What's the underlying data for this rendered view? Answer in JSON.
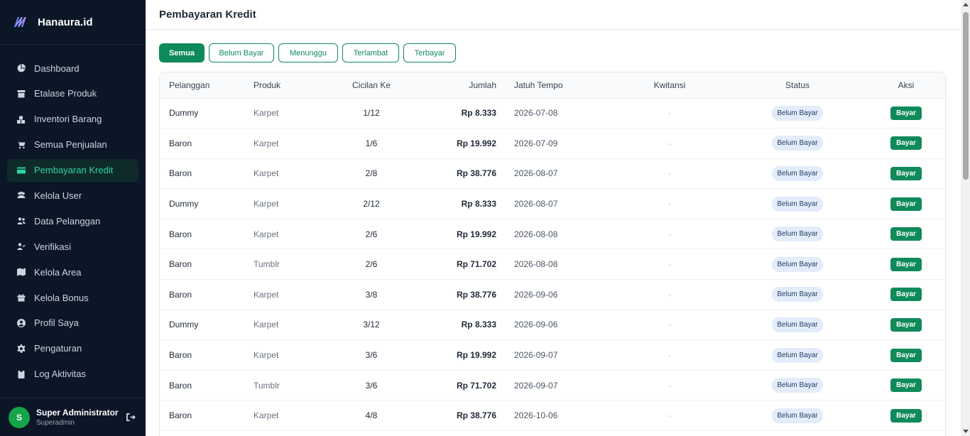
{
  "brand": {
    "name": "Hanaura.id"
  },
  "sidebar": {
    "items": [
      {
        "label": "Dashboard",
        "icon": "pie-chart-icon"
      },
      {
        "label": "Etalase Produk",
        "icon": "box-icon"
      },
      {
        "label": "Inventori Barang",
        "icon": "warehouse-icon"
      },
      {
        "label": "Semua Penjualan",
        "icon": "cart-icon"
      },
      {
        "label": "Pembayaran Kredit",
        "icon": "credit-card-icon",
        "active": true
      },
      {
        "label": "Kelola User",
        "icon": "users-icon"
      },
      {
        "label": "Data Pelanggan",
        "icon": "customers-icon"
      },
      {
        "label": "Verifikasi",
        "icon": "user-check-icon"
      },
      {
        "label": "Kelola Area",
        "icon": "map-icon"
      },
      {
        "label": "Kelola Bonus",
        "icon": "gift-icon"
      },
      {
        "label": "Profil Saya",
        "icon": "user-circle-icon"
      },
      {
        "label": "Pengaturan",
        "icon": "gear-icon"
      },
      {
        "label": "Log Aktivitas",
        "icon": "clipboard-icon"
      }
    ]
  },
  "user": {
    "initial": "S",
    "name": "Super Administrator",
    "role": "Superadmin"
  },
  "header": {
    "title": "Pembayaran Kredit"
  },
  "filters": [
    {
      "label": "Semua",
      "active": true
    },
    {
      "label": "Belum Bayar"
    },
    {
      "label": "Menunggu"
    },
    {
      "label": "Terlambat"
    },
    {
      "label": "Terbayar"
    }
  ],
  "table": {
    "columns": [
      "Pelanggan",
      "Produk",
      "Cicilan Ke",
      "Jumlah",
      "Jatuh Tempo",
      "Kwitansi",
      "Status",
      "Aksi"
    ],
    "rows": [
      {
        "pelanggan": "Dummy",
        "produk": "Karpet",
        "cicilan": "1/12",
        "jumlah": "Rp 8.333",
        "jatuh_tempo": "2026-07-08",
        "kwitansi": "-",
        "status": "Belum Bayar",
        "aksi": "Bayar"
      },
      {
        "pelanggan": "Baron",
        "produk": "Karpet",
        "cicilan": "1/6",
        "jumlah": "Rp 19.992",
        "jatuh_tempo": "2026-07-09",
        "kwitansi": "-",
        "status": "Belum Bayar",
        "aksi": "Bayar"
      },
      {
        "pelanggan": "Baron",
        "produk": "Karpet",
        "cicilan": "2/8",
        "jumlah": "Rp 38.776",
        "jatuh_tempo": "2026-08-07",
        "kwitansi": "-",
        "status": "Belum Bayar",
        "aksi": "Bayar"
      },
      {
        "pelanggan": "Dummy",
        "produk": "Karpet",
        "cicilan": "2/12",
        "jumlah": "Rp 8.333",
        "jatuh_tempo": "2026-08-07",
        "kwitansi": "-",
        "status": "Belum Bayar",
        "aksi": "Bayar"
      },
      {
        "pelanggan": "Baron",
        "produk": "Karpet",
        "cicilan": "2/6",
        "jumlah": "Rp 19.992",
        "jatuh_tempo": "2026-08-08",
        "kwitansi": "-",
        "status": "Belum Bayar",
        "aksi": "Bayar"
      },
      {
        "pelanggan": "Baron",
        "produk": "Tumblr",
        "cicilan": "2/6",
        "jumlah": "Rp 71.702",
        "jatuh_tempo": "2026-08-08",
        "kwitansi": "-",
        "status": "Belum Bayar",
        "aksi": "Bayar"
      },
      {
        "pelanggan": "Baron",
        "produk": "Karpet",
        "cicilan": "3/8",
        "jumlah": "Rp 38.776",
        "jatuh_tempo": "2026-09-06",
        "kwitansi": "-",
        "status": "Belum Bayar",
        "aksi": "Bayar"
      },
      {
        "pelanggan": "Dummy",
        "produk": "Karpet",
        "cicilan": "3/12",
        "jumlah": "Rp 8.333",
        "jatuh_tempo": "2026-09-06",
        "kwitansi": "-",
        "status": "Belum Bayar",
        "aksi": "Bayar"
      },
      {
        "pelanggan": "Baron",
        "produk": "Karpet",
        "cicilan": "3/6",
        "jumlah": "Rp 19.992",
        "jatuh_tempo": "2026-09-07",
        "kwitansi": "-",
        "status": "Belum Bayar",
        "aksi": "Bayar"
      },
      {
        "pelanggan": "Baron",
        "produk": "Tumblr",
        "cicilan": "3/6",
        "jumlah": "Rp 71.702",
        "jatuh_tempo": "2026-09-07",
        "kwitansi": "-",
        "status": "Belum Bayar",
        "aksi": "Bayar"
      },
      {
        "pelanggan": "Baron",
        "produk": "Karpet",
        "cicilan": "4/8",
        "jumlah": "Rp 38.776",
        "jatuh_tempo": "2026-10-06",
        "kwitansi": "-",
        "status": "Belum Bayar",
        "aksi": "Bayar"
      }
    ]
  },
  "colors": {
    "sidebar_bg": "#0b1727",
    "accent": "#0f8a5a",
    "active_text": "#2dd4a0",
    "badge_bg": "#e3ecfa"
  }
}
